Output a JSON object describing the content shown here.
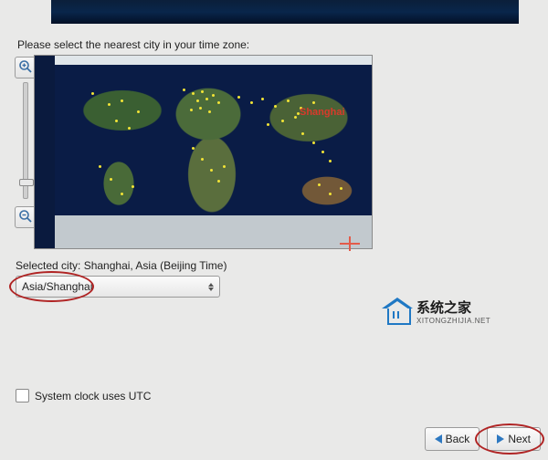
{
  "prompt": "Please select the nearest city in your time zone:",
  "selected_city_label": "Selected city: Shanghai, Asia (Beijing Time)",
  "timezone_combo": {
    "value": "Asia/Shanghai"
  },
  "map": {
    "city_label": "Shanghai"
  },
  "checkbox": {
    "label": "System clock uses UTC",
    "checked": false
  },
  "buttons": {
    "back": "Back",
    "next": "Next"
  },
  "branding": {
    "cn": "系统之家",
    "en": "XITONGZHIJIA.NET"
  },
  "icons": {
    "zoom_in": "zoom-in-icon",
    "zoom_out": "zoom-out-icon",
    "back_arrow": "arrow-left-icon",
    "next_arrow": "arrow-right-icon",
    "house": "house-logo-icon"
  }
}
